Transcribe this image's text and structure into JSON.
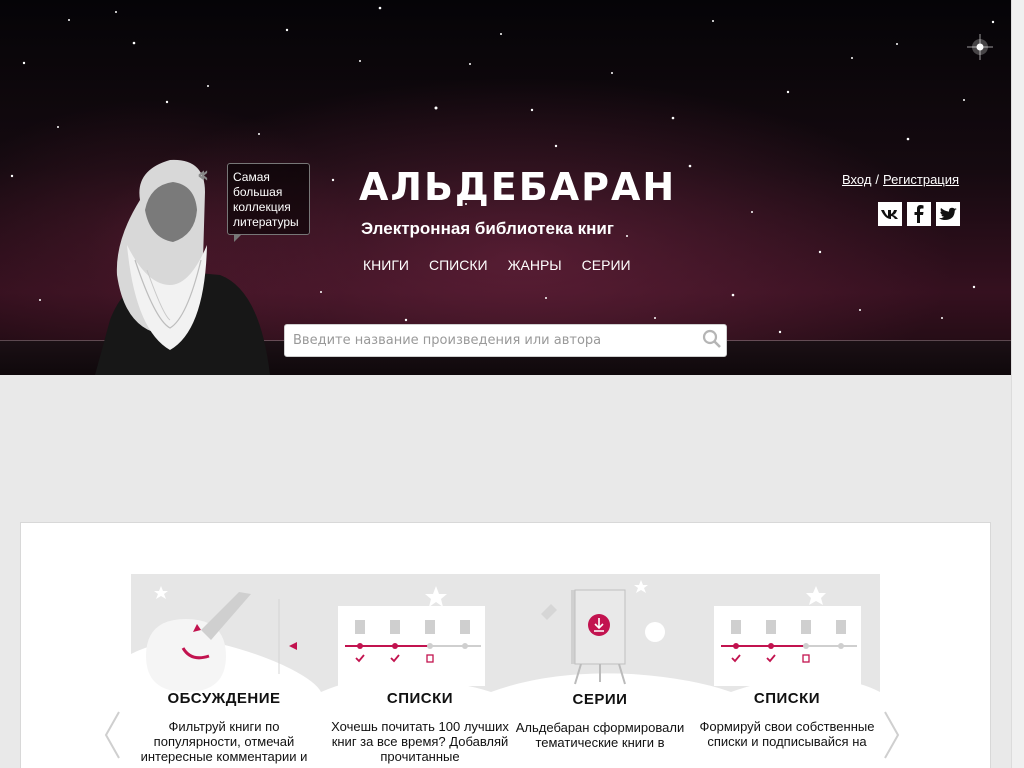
{
  "header": {
    "title": "АЛЬДЕБАРАН",
    "subtitle": "Электронная библиотека книг",
    "bubble_text": "Самая большая коллекция литературы",
    "nav": [
      "КНИГИ",
      "СПИСКИ",
      "ЖАНРЫ",
      "СЕРИИ"
    ],
    "auth": {
      "login": "Вход",
      "separator": "/",
      "register": "Регистрация"
    },
    "social": [
      {
        "name": "vk-icon",
        "glyph": "vk"
      },
      {
        "name": "facebook-icon",
        "glyph": "f"
      },
      {
        "name": "twitter-icon",
        "glyph": "t"
      }
    ]
  },
  "search": {
    "placeholder": "Введите название произведения или автора"
  },
  "features": [
    {
      "title": "ОБСУЖДЕНИЕ",
      "text": "Фильтруй книги по популярности, отмечай интересные комментарии и"
    },
    {
      "title": "СПИСКИ",
      "text": "Хочешь почитать 100 лучших книг за все время? Добавляй прочитанные"
    },
    {
      "title": "СЕРИИ",
      "text": "Альдебаран сформировали тематические книги в"
    },
    {
      "title": "СПИСКИ",
      "text": "Формируй свои собственные списки и подписывайся на"
    }
  ],
  "colors": {
    "accent": "#c2134f",
    "header_bg": "#150a10",
    "page_bg": "#e9e9e9"
  }
}
